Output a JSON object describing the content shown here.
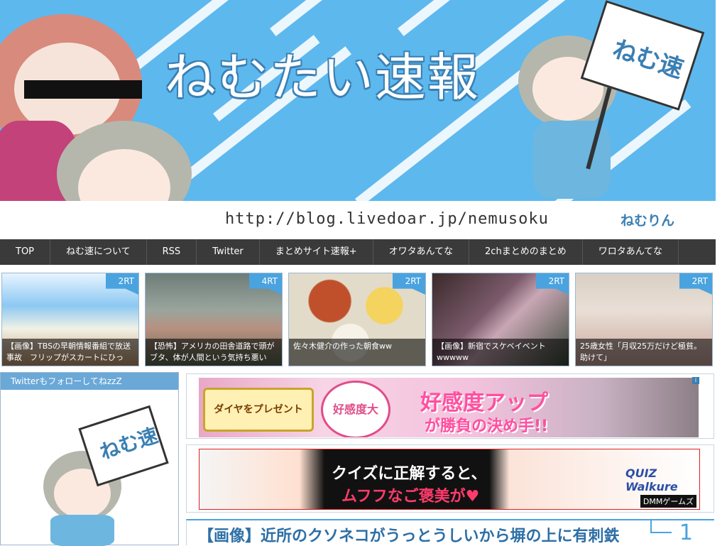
{
  "header": {
    "logo_text": "ねむたい速報",
    "url_text": "http://blog.livedoar.jp/nemusoku",
    "signature": "ねむりん",
    "sign_text": "ねむ速"
  },
  "nav": {
    "items": [
      "TOP",
      "ねむ速について",
      "RSS",
      "Twitter",
      "まとめサイト速報+",
      "オワタあんてな",
      "2chまとめのまとめ",
      "ワロタあんてな"
    ]
  },
  "thumbs": [
    {
      "badge": "2RT",
      "caption": "【画像】TBSの早朝情報番組で放送事故　フリップがスカートにひっ"
    },
    {
      "badge": "4RT",
      "caption": "【恐怖】アメリカの田舎道路で頭がブタ、体が人間という気持ち悪い"
    },
    {
      "badge": "2RT",
      "caption": "佐々木健介の作った朝食ww"
    },
    {
      "badge": "2RT",
      "caption": "【画像】新宿でスケベイベントwwwww"
    },
    {
      "badge": "2RT",
      "caption": "25歳女性「月収25万だけど極貧。助けて」"
    }
  ],
  "sidebar": {
    "heading": "TwitterもフォローしてねzzZ",
    "sign_text": "ねむ速"
  },
  "ads": {
    "ad1": {
      "left_label": "ダイヤをプレゼント",
      "mid_label": "好感度大",
      "main_text": "好感度アップ",
      "sub_text": "が勝負の決め手!!",
      "info": "i"
    },
    "ad2": {
      "main_text": "クイズに正解すると、",
      "sub_text": "ムフフなご褒美が♥",
      "brand": "DMMゲームズ",
      "logo": "QUIZ Walkure"
    }
  },
  "post": {
    "title": "【画像】近所のクソネコがうっとうしいから塀の上に有刺鉄",
    "number": "1"
  },
  "colors": {
    "header_bg": "#5db8ee",
    "nav_bg": "#3a3a3a",
    "accent": "#4aa3df"
  }
}
